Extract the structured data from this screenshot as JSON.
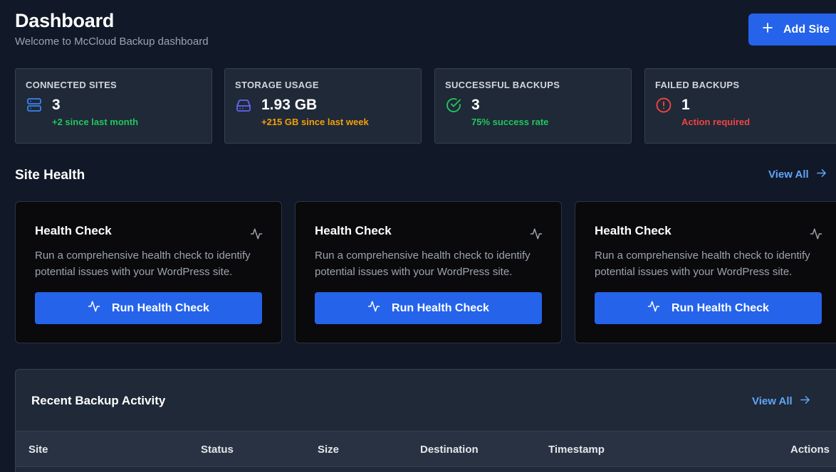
{
  "header": {
    "title": "Dashboard",
    "subtitle": "Welcome to McCloud Backup dashboard",
    "add_site_label": "Add Site"
  },
  "stats": [
    {
      "label": "CONNECTED SITES",
      "value": "3",
      "note": "+2 since last month",
      "icon": "server-icon",
      "icon_color": "#3b82f6",
      "note_color": "#22c55e"
    },
    {
      "label": "STORAGE USAGE",
      "value": "1.93 GB",
      "note": "+215 GB since last week",
      "icon": "hard-drive-icon",
      "icon_color": "#6366f1",
      "note_color": "#f59e0b"
    },
    {
      "label": "SUCCESSFUL BACKUPS",
      "value": "3",
      "note": "75% success rate",
      "icon": "check-circle-icon",
      "icon_color": "#22c55e",
      "note_color": "#22c55e"
    },
    {
      "label": "FAILED BACKUPS",
      "value": "1",
      "note": "Action required",
      "icon": "alert-circle-icon",
      "icon_color": "#ef4444",
      "note_color": "#ef4444"
    }
  ],
  "site_health": {
    "title": "Site Health",
    "view_all": "View All",
    "cards": [
      {
        "title": "Health Check",
        "description": "Run a comprehensive health check to identify potential issues with your WordPress site.",
        "button": "Run Health Check"
      },
      {
        "title": "Health Check",
        "description": "Run a comprehensive health check to identify potential issues with your WordPress site.",
        "button": "Run Health Check"
      },
      {
        "title": "Health Check",
        "description": "Run a comprehensive health check to identify potential issues with your WordPress site.",
        "button": "Run Health Check"
      }
    ]
  },
  "activity": {
    "title": "Recent Backup Activity",
    "view_all": "View All",
    "columns": [
      "Site",
      "Status",
      "Size",
      "Destination",
      "Timestamp",
      "Actions"
    ]
  },
  "colors": {
    "accent": "#2563eb",
    "link": "#60a5fa",
    "background": "#111827",
    "card": "#1f2937"
  }
}
